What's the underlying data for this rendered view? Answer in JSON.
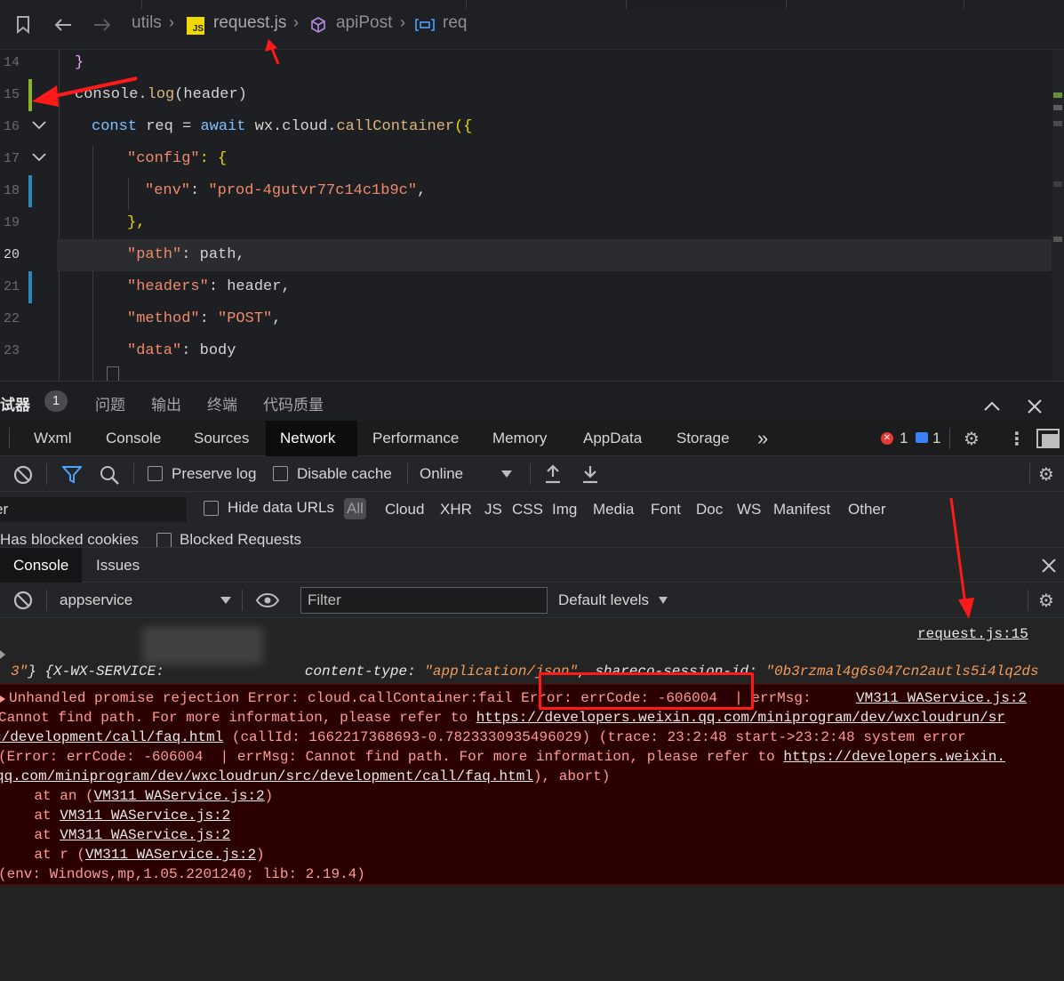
{
  "breadcrumb": {
    "folder": "utils",
    "file_badge": "JS",
    "file": "request.js",
    "function": "apiPost",
    "variable": "req"
  },
  "editor": {
    "lines": [
      {
        "num": "14",
        "text": "}"
      },
      {
        "num": "15",
        "text": "console.log(header)"
      },
      {
        "num": "16",
        "text": "const req = await wx.cloud.callContainer({"
      },
      {
        "num": "17",
        "text": "\"config\": {"
      },
      {
        "num": "18",
        "text": "\"env\": \"prod-4gutvr77c14c1b9c\","
      },
      {
        "num": "19",
        "text": "},"
      },
      {
        "num": "20",
        "text": "\"path\": path,"
      },
      {
        "num": "21",
        "text": "\"headers\": header,"
      },
      {
        "num": "22",
        "text": "\"method\": \"POST\","
      },
      {
        "num": "23",
        "text": "\"data\": body"
      }
    ],
    "tokens": {
      "l14_brace": "}",
      "l15_console": "console",
      "l15_dot": ".",
      "l15_log": "log",
      "l15_args": "(header)",
      "l16_const": "const",
      "l16_req": " req ",
      "l16_eq": "= ",
      "l16_await": "await",
      "l16_wx": " wx.cloud.",
      "l16_fn": "callContainer",
      "l16_open": "({",
      "l17_key": "\"config\"",
      "l17_rest": ": {",
      "l18_key": "\"env\"",
      "l18_colon": ": ",
      "l18_val": "\"prod-4gutvr77c14c1b9c\"",
      "l18_comma": ",",
      "l19_text": "},",
      "l20_key": "\"path\"",
      "l20_rest": ": path,",
      "l21_key": "\"headers\"",
      "l21_rest": ": header,",
      "l22_key": "\"method\"",
      "l22_colon": ": ",
      "l22_val": "\"POST\"",
      "l22_comma": ",",
      "l23_key": "\"data\"",
      "l23_rest": ": body"
    }
  },
  "panel": {
    "tabs": [
      {
        "label": "调试器"
      },
      {
        "label": "问题"
      },
      {
        "label": "输出"
      },
      {
        "label": "终端"
      },
      {
        "label": "代码质量"
      }
    ],
    "badge": "1"
  },
  "devtools": {
    "tabs": [
      "Wxml",
      "Console",
      "Sources",
      "Network",
      "Performance",
      "Memory",
      "AppData",
      "Storage"
    ],
    "selected_tab": "Network",
    "more": "»",
    "error_count": "1",
    "message_count": "1"
  },
  "network": {
    "preserve_log": "Preserve log",
    "disable_cache": "Disable cache",
    "throttle": "Online",
    "filter_text": "er",
    "hide_data_urls": "Hide data URLs",
    "types": [
      "All",
      "Cloud",
      "XHR",
      "JS",
      "CSS",
      "Img",
      "Media",
      "Font",
      "Doc",
      "WS",
      "Manifest",
      "Other"
    ],
    "has_blocked_cookies": "Has blocked cookies",
    "blocked_requests": "Blocked Requests"
  },
  "console": {
    "tabs": [
      "Console",
      "Issues"
    ],
    "context": "appservice",
    "filter_placeholder": "Filter",
    "levels": "Default levels",
    "log_source": "request.js:15",
    "log": {
      "open": "{",
      "k1": "X-WX-SERVICE:",
      "k2": "content-type:",
      "v2": "\"application/json\"",
      "sep": ",",
      "k3": "shareco-session-id:",
      "v3": "\"0b3rzmal4g6s047cn2autls5i4lq2ds",
      "v3_cont": "3\"",
      "close": "}"
    },
    "error": {
      "source": "VM311 WAService.js:2",
      "l1": "Unhandled promise rejection Error: cloud.callContainer:fail Error: errCode: -606004  | errMsg: ",
      "l2a": "Cannot find path. For more information, please refer to ",
      "l2b": "https://developers.weixin.qq.com/miniprogram/dev/wxcloudrun/sr",
      "l3a": "c/development/call/faq.html",
      "l3b": " (callId: 1662217368693-0.7823330935496029) (trace: 23:2:48 start->23:2:48 system error",
      "l4a": "(Error: errCode: -606004  | errMsg: Cannot find path. For more information, please refer to ",
      "l4b": "https://developers.weixin.",
      "l5a": "qq.com/miniprogram/dev/wxcloudrun/src/development/call/faq.html",
      "l5b": "), abort)",
      "s1a": "    at an (",
      "s1b": "VM311 WAService.js:2",
      "s1c": ")",
      "s2a": "    at ",
      "s2b": "VM311 WAService.js:2",
      "s3a": "    at ",
      "s3b": "VM311 WAService.js:2",
      "s4a": "    at r (",
      "s4b": "VM311 WAService.js:2",
      "s4c": ")",
      "env": "(env: Windows,mp,1.05.2201240; lib: 2.19.4)"
    }
  },
  "colors": {
    "accent_blue": "#4da3ff",
    "error_red": "#ff1a1a",
    "error_bg": "#2a0000"
  }
}
